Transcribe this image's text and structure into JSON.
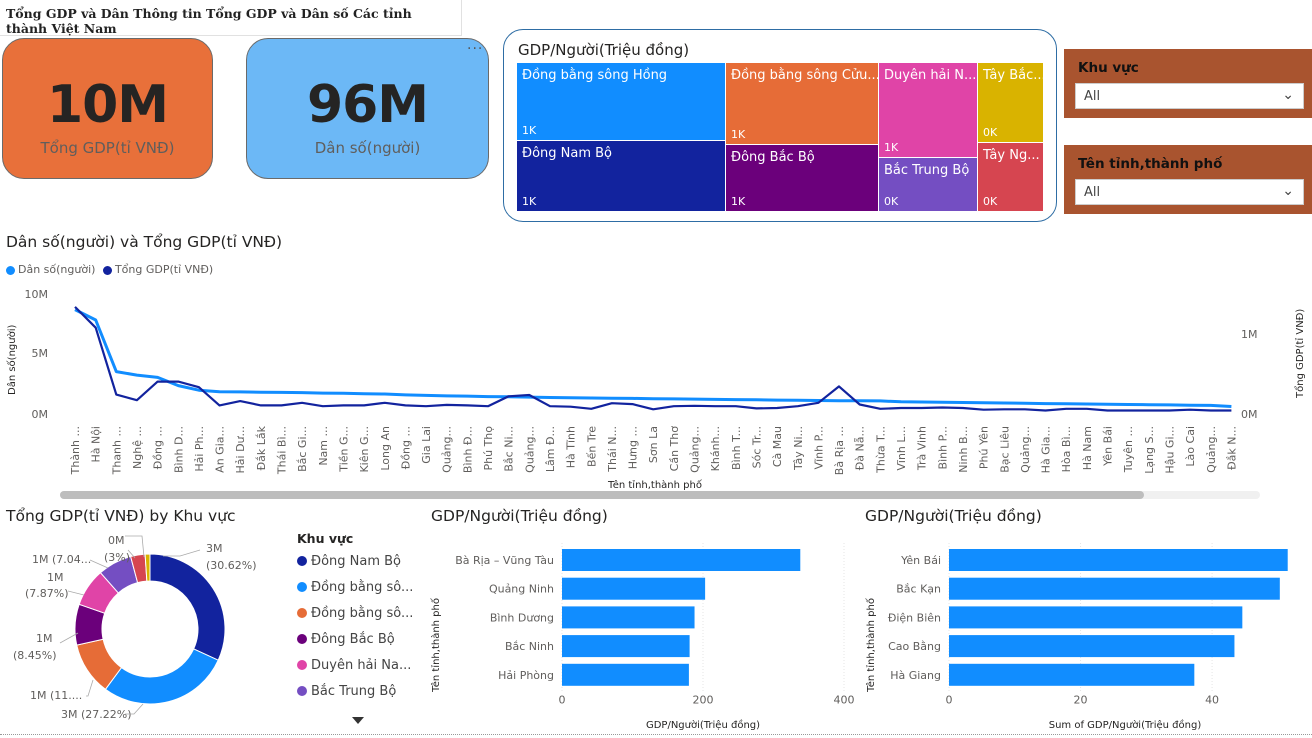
{
  "page_title": "Tổng GDP và Dân Thông tin Tổng GDP và Dân số Các tỉnh thành Việt Nam",
  "kpi_gdp": {
    "value": "10M",
    "label": "Tổng GDP(tỉ VNĐ)",
    "color": "#e8703a"
  },
  "kpi_pop": {
    "value": "96M",
    "label": "Dân số(người)",
    "color": "#6cb8f6"
  },
  "more_options": "···",
  "treemap": {
    "title": "GDP/Người(Triệu đồng)",
    "cells": [
      {
        "name": "Đồng bằng sông Hồng",
        "value": "1K",
        "color": "#118dff"
      },
      {
        "name": "Đông Nam Bộ",
        "value": "1K",
        "color": "#12239e"
      },
      {
        "name": "Đồng bằng sông Cửu...",
        "value": "1K",
        "color": "#e66c37"
      },
      {
        "name": "Đông Bắc Bộ",
        "value": "1K",
        "color": "#6b007b"
      },
      {
        "name": "Duyên hải N...",
        "value": "1K",
        "color": "#e044a7"
      },
      {
        "name": "Bắc Trung Bộ",
        "value": "0K",
        "color": "#744ec2"
      },
      {
        "name": "Tây Bắc...",
        "value": "0K",
        "color": "#d9b300"
      },
      {
        "name": "Tây Ng...",
        "value": "0K",
        "color": "#d64550"
      }
    ]
  },
  "slicer_region": {
    "title": "Khu vực",
    "selected": "All"
  },
  "slicer_province": {
    "title": "Tên tỉnh,thành phố",
    "selected": "All"
  },
  "line_section": {
    "title": "Dân số(người) và Tổng GDP(tỉ VNĐ)",
    "legend": [
      {
        "name": "Dân số(người)",
        "color": "#118dff"
      },
      {
        "name": "Tổng GDP(tỉ VNĐ)",
        "color": "#12239e"
      }
    ],
    "left_ticks": [
      "10M",
      "5M",
      "0M"
    ],
    "right_ticks": [
      "1M",
      "0M"
    ],
    "left_axis_title": "Dân số(người)",
    "right_axis_title": "Tổng GDP(tỉ VNĐ)",
    "x_axis_title": "Tên tỉnh,thành phố"
  },
  "donut_section": {
    "title": "Tổng GDP(tỉ VNĐ) by Khu vực",
    "legend_title": "Khu vực",
    "legend": [
      {
        "name": "Đông Nam Bộ",
        "color": "#12239e"
      },
      {
        "name": "Đồng bằng sô...",
        "color": "#118dff"
      },
      {
        "name": "Đồng bằng sô...",
        "color": "#e66c37"
      },
      {
        "name": "Đông Bắc Bộ",
        "color": "#6b007b"
      },
      {
        "name": "Duyên hải Na...",
        "color": "#e044a7"
      },
      {
        "name": "Bắc Trung Bộ",
        "color": "#744ec2"
      }
    ],
    "labels": [
      {
        "l1": "3M",
        "l2": "(30.62%)"
      },
      {
        "l1": "3M (27.22%)",
        "l2": ""
      },
      {
        "l1": "1M (11....",
        "l2": ""
      },
      {
        "l1": "1M",
        "l2": "(8.45%)"
      },
      {
        "l1": "1M",
        "l2": "(7.87%)"
      },
      {
        "l1": "1M (7.04...",
        "l2": ""
      },
      {
        "l1": "0M",
        "l2": "(3%)"
      }
    ]
  },
  "bar1_section": {
    "title": "GDP/Người(Triệu đồng)",
    "x_axis_title": "GDP/Người(Triệu đồng)",
    "y_axis_title": "Tên tỉnh,thành phố"
  },
  "bar2_section": {
    "title": "GDP/Người(Triệu đồng)",
    "x_axis_title": "Sum of GDP/Người(Triệu đồng)",
    "y_axis_title": "Tên tỉnh,thành phố"
  },
  "chart_data": [
    {
      "type": "line",
      "title": "Dân số(người) và Tổng GDP(tỉ VNĐ)",
      "xlabel": "Tên tỉnh,thành phố",
      "ylabel": "Dân số(người)",
      "y2label": "Tổng GDP(tỉ VNĐ)",
      "x": [
        "Thành ...",
        "Hà Nội",
        "Thanh ...",
        "Nghệ ...",
        "Đồng ...",
        "Bình D...",
        "Hải Ph...",
        "An Gia...",
        "Hải Dư...",
        "Đắk Lắk",
        "Thái Bì...",
        "Bắc Gi...",
        "Nam ...",
        "Tiền G...",
        "Kiên G...",
        "Long An",
        "Đồng ...",
        "Gia Lai",
        "Quảng...",
        "Bình Đ...",
        "Phú Thọ",
        "Bắc Ni...",
        "Quảng...",
        "Lâm Đ...",
        "Hà Tĩnh",
        "Bến Tre",
        "Thái N...",
        "Hưng ...",
        "Sơn La",
        "Cần Thơ",
        "Quảng...",
        "Khánh...",
        "Bình T...",
        "Sóc Tr...",
        "Cà Mau",
        "Tây Ni...",
        "Vĩnh P...",
        "Bà Rịa ...",
        "Đà Nẵ...",
        "Thừa T...",
        "Vĩnh L...",
        "Trà Vinh",
        "Bình P...",
        "Ninh B...",
        "Phú Yên",
        "Bạc Liêu",
        "Quảng...",
        "Hà Gia...",
        "Hòa Bì...",
        "Hà Nam",
        "Yên Bái",
        "Tuyên ...",
        "Lạng S...",
        "Hậu Gi...",
        "Lào Cai",
        "Quảng...",
        "Đắk N..."
      ],
      "ylim": [
        0,
        11000000
      ],
      "y2lim": [
        0,
        1390000
      ],
      "series": [
        {
          "name": "Dân số(người)",
          "axis": "left",
          "values": [
            9000000,
            8100000,
            3650000,
            3350000,
            3150000,
            2450000,
            2050000,
            1920000,
            1900000,
            1880000,
            1860000,
            1840000,
            1800000,
            1780000,
            1740000,
            1720000,
            1650000,
            1600000,
            1560000,
            1540000,
            1500000,
            1480000,
            1460000,
            1420000,
            1400000,
            1380000,
            1360000,
            1340000,
            1320000,
            1300000,
            1280000,
            1260000,
            1240000,
            1220000,
            1200000,
            1180000,
            1160000,
            1150000,
            1140000,
            1130000,
            1050000,
            1030000,
            1010000,
            990000,
            970000,
            950000,
            920000,
            900000,
            880000,
            860000,
            840000,
            820000,
            800000,
            780000,
            760000,
            740000,
            650000
          ]
        },
        {
          "name": "Tổng GDP(tỉ VNĐ)",
          "axis": "right",
          "values": [
            1240000,
            1000000,
            225000,
            160000,
            375000,
            375000,
            310000,
            100000,
            150000,
            100000,
            100000,
            130000,
            90000,
            100000,
            100000,
            130000,
            100000,
            90000,
            105000,
            100000,
            90000,
            205000,
            220000,
            90000,
            85000,
            60000,
            125000,
            115000,
            55000,
            90000,
            95000,
            90000,
            90000,
            65000,
            70000,
            90000,
            130000,
            320000,
            110000,
            60000,
            70000,
            70000,
            75000,
            70000,
            50000,
            55000,
            55000,
            40000,
            60000,
            60000,
            40000,
            40000,
            40000,
            40000,
            50000,
            40000,
            40000
          ]
        }
      ]
    },
    {
      "type": "pie",
      "title": "Tổng GDP(tỉ VNĐ) by Khu vực",
      "categories": [
        "Đông Nam Bộ",
        "Đồng bằng sông Hồng",
        "Đồng bằng sông Cửu Long",
        "Đông Bắc Bộ",
        "Duyên hải Nam Trung Bộ",
        "Bắc Trung Bộ",
        "Tây Nguyên"
      ],
      "values": [
        30.62,
        27.22,
        11.0,
        8.45,
        7.87,
        7.04,
        3.0
      ],
      "colors": [
        "#12239e",
        "#118dff",
        "#e66c37",
        "#6b007b",
        "#e044a7",
        "#744ec2",
        "#d64550"
      ],
      "extra_colors": [
        "#d9b300"
      ]
    },
    {
      "type": "bar",
      "title": "GDP/Người(Triệu đồng)",
      "categories": [
        "Bà Rịa – Vũng Tàu",
        "Quảng Ninh",
        "Bình Dương",
        "Bắc Ninh",
        "Hải Phòng"
      ],
      "values": [
        338,
        203,
        188,
        181,
        180
      ],
      "xlabel": "GDP/Người(Triệu đồng)",
      "ylabel": "Tên tỉnh,thành phố",
      "xlim": [
        0,
        400
      ],
      "xticks": [
        "0",
        "200",
        "400"
      ]
    },
    {
      "type": "bar",
      "title": "GDP/Người(Triệu đồng)",
      "categories": [
        "Yên Bái",
        "Bắc Kạn",
        "Điện Biên",
        "Cao Bằng",
        "Hà Giang"
      ],
      "values": [
        51.5,
        50.3,
        44.6,
        43.4,
        37.3
      ],
      "xlabel": "Sum of GDP/Người(Triệu đồng)",
      "ylabel": "Tên tỉnh,thành phố",
      "xlim": [
        0,
        52
      ],
      "xticks": [
        "0",
        "20",
        "40"
      ]
    }
  ]
}
